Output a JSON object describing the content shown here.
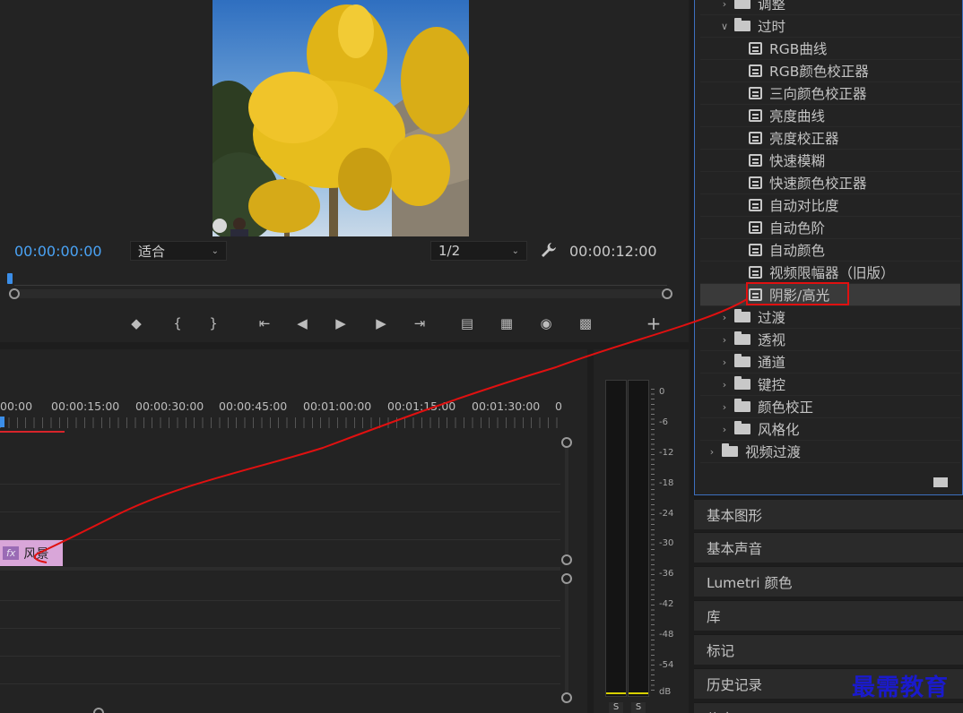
{
  "program_monitor": {
    "current_timecode": "00:00:00:00",
    "fit_label": "适合",
    "resolution": "1/2",
    "duration": "00:00:12:00"
  },
  "timeline": {
    "ruler_labels": [
      "00:00",
      "00:00:15:00",
      "00:00:30:00",
      "00:00:45:00",
      "00:01:00:00",
      "00:01:15:00",
      "00:01:30:00",
      "0"
    ],
    "clip": {
      "fx_label": "fx",
      "name": "风景"
    }
  },
  "audio_meter": {
    "db_labels": [
      "0",
      "-6",
      "-12",
      "-18",
      "-24",
      "-30",
      "-36",
      "-42",
      "-48",
      "-54",
      "dB"
    ],
    "solo_buttons": [
      "S",
      "S"
    ]
  },
  "effects_panel": {
    "rows": [
      {
        "kind": "folder",
        "label": "调整",
        "expanded": false,
        "depth": 1
      },
      {
        "kind": "folder",
        "label": "过时",
        "expanded": true,
        "depth": 1
      },
      {
        "kind": "effect",
        "label": "RGB曲线",
        "depth": 2
      },
      {
        "kind": "effect",
        "label": "RGB颜色校正器",
        "depth": 2
      },
      {
        "kind": "effect",
        "label": "三向颜色校正器",
        "depth": 2
      },
      {
        "kind": "effect",
        "label": "亮度曲线",
        "depth": 2
      },
      {
        "kind": "effect",
        "label": "亮度校正器",
        "depth": 2
      },
      {
        "kind": "effect",
        "label": "快速模糊",
        "depth": 2
      },
      {
        "kind": "effect",
        "label": "快速颜色校正器",
        "depth": 2
      },
      {
        "kind": "effect",
        "label": "自动对比度",
        "depth": 2
      },
      {
        "kind": "effect",
        "label": "自动色阶",
        "depth": 2
      },
      {
        "kind": "effect",
        "label": "自动颜色",
        "depth": 2
      },
      {
        "kind": "effect",
        "label": "视频限幅器（旧版）",
        "depth": 2
      },
      {
        "kind": "effect",
        "label": "阴影/高光",
        "depth": 2,
        "selected": true
      },
      {
        "kind": "folder",
        "label": "过渡",
        "expanded": false,
        "depth": 1
      },
      {
        "kind": "folder",
        "label": "透视",
        "expanded": false,
        "depth": 1
      },
      {
        "kind": "folder",
        "label": "通道",
        "expanded": false,
        "depth": 1
      },
      {
        "kind": "folder",
        "label": "键控",
        "expanded": false,
        "depth": 1
      },
      {
        "kind": "folder",
        "label": "颜色校正",
        "expanded": false,
        "depth": 1
      },
      {
        "kind": "folder",
        "label": "风格化",
        "expanded": false,
        "depth": 1
      },
      {
        "kind": "folder",
        "label": "视频过渡",
        "expanded": false,
        "depth": 0
      }
    ]
  },
  "collapsed_panels": [
    "基本图形",
    "基本声音",
    "Lumetri 颜色",
    "库",
    "标记",
    "历史记录",
    "信息"
  ],
  "watermark": "最需教育",
  "colors": {
    "timecode_blue": "#4aa3f5",
    "selection_red": "#e01010",
    "panel_focus_blue": "#3d6fbf",
    "clip_pink": "#d9a6d9",
    "watermark_blue": "#1a1acc"
  }
}
